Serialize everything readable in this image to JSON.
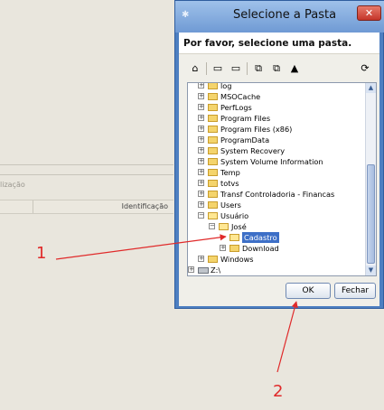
{
  "background": {
    "partial_label": "lização",
    "column_header": "Identificação"
  },
  "dialog": {
    "title": "Selecione a Pasta",
    "close_icon": "close-icon",
    "prompt": "Por favor, selecione uma pasta.",
    "toolbar": [
      "home-icon",
      "new-folder-icon",
      "delete-folder-icon",
      "copy-icon",
      "paste-icon",
      "properties-icon",
      "refresh-icon"
    ],
    "tree": [
      {
        "label": "log",
        "expander": "+"
      },
      {
        "label": "MSOCache",
        "expander": "+"
      },
      {
        "label": "PerfLogs",
        "expander": "+"
      },
      {
        "label": "Program Files",
        "expander": "+"
      },
      {
        "label": "Program Files (x86)",
        "expander": "+"
      },
      {
        "label": "ProgramData",
        "expander": "+"
      },
      {
        "label": "System Recovery",
        "expander": "+"
      },
      {
        "label": "System Volume Information",
        "expander": "+"
      },
      {
        "label": "Temp",
        "expander": "+"
      },
      {
        "label": "totvs",
        "expander": "+"
      },
      {
        "label": "Transf Controladoria - Financas",
        "expander": "+"
      },
      {
        "label": "Users",
        "expander": "+"
      },
      {
        "label": "Usuário",
        "expander": "−"
      },
      {
        "label": "José",
        "expander": "−"
      },
      {
        "label": "Cadastro",
        "expander": ""
      },
      {
        "label": "Download",
        "expander": "+"
      },
      {
        "label": "Windows",
        "expander": "+"
      },
      {
        "label": "Z:\\",
        "expander": "+"
      }
    ],
    "ok_label": "OK",
    "cancel_label": "Fechar"
  },
  "annotations": {
    "one": "1",
    "two": "2"
  },
  "colors": {
    "arrow": "#e02a2a",
    "selection": "#3d6fc7"
  }
}
